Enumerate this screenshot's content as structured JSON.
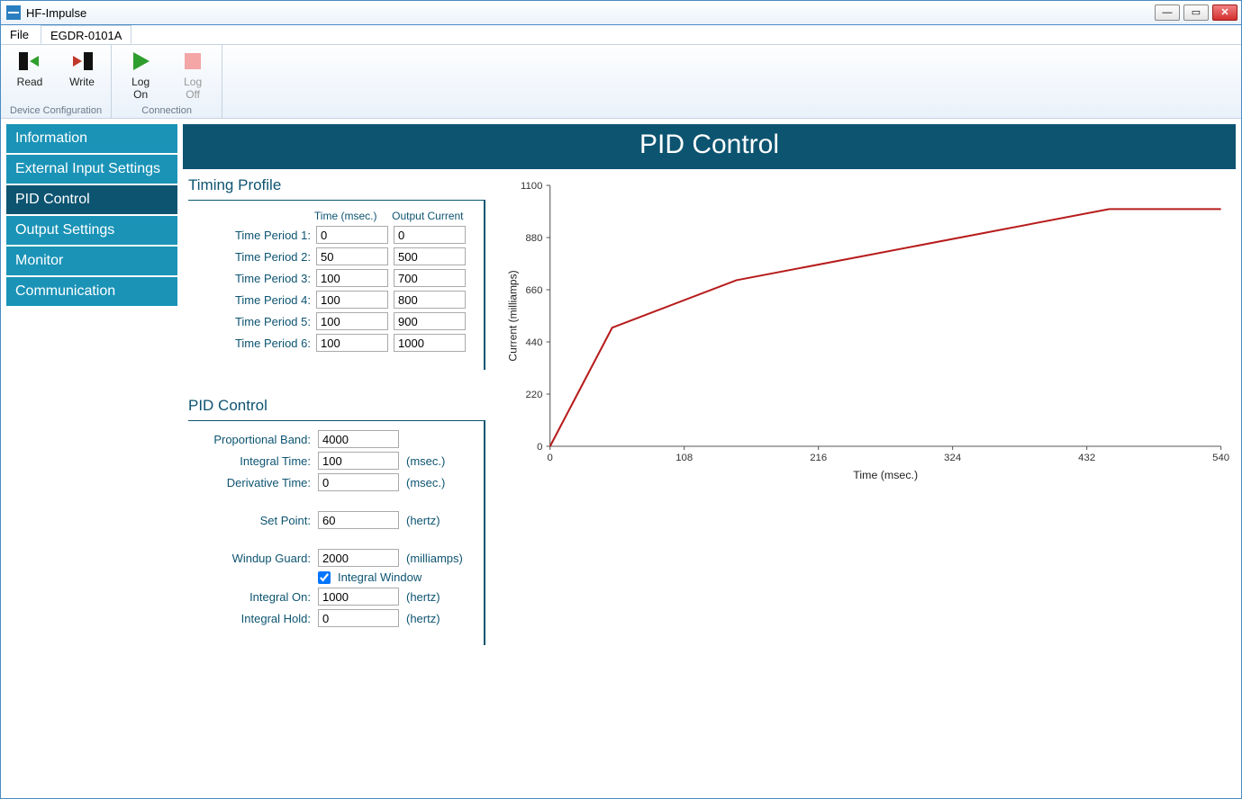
{
  "window": {
    "title": "HF-Impulse"
  },
  "menubar": {
    "file": "File",
    "device_tab": "EGDR-0101A"
  },
  "ribbon": {
    "read": "Read",
    "write": "Write",
    "logon": "Log\nOn",
    "logoff": "Log\nOff",
    "group_device": "Device Configuration",
    "group_conn": "Connection"
  },
  "sidebar": {
    "items": [
      "Information",
      "External Input Settings",
      "PID Control",
      "Output Settings",
      "Monitor",
      "Communication"
    ],
    "active_index": 2
  },
  "page": {
    "title": "PID Control"
  },
  "timing": {
    "section_title": "Timing Profile",
    "col_time": "Time (msec.)",
    "col_output": "Output Current",
    "rows": [
      {
        "label": "Time Period 1:",
        "time": "0",
        "out": "0"
      },
      {
        "label": "Time Period 2:",
        "time": "50",
        "out": "500"
      },
      {
        "label": "Time Period 3:",
        "time": "100",
        "out": "700"
      },
      {
        "label": "Time Period 4:",
        "time": "100",
        "out": "800"
      },
      {
        "label": "Time Period 5:",
        "time": "100",
        "out": "900"
      },
      {
        "label": "Time Period 6:",
        "time": "100",
        "out": "1000"
      }
    ]
  },
  "pid": {
    "section_title": "PID Control",
    "proportional_label": "Proportional Band:",
    "proportional": "4000",
    "integral_time_label": "Integral Time:",
    "integral_time": "100",
    "integral_time_unit": "(msec.)",
    "derivative_time_label": "Derivative Time:",
    "derivative_time": "0",
    "derivative_time_unit": "(msec.)",
    "setpoint_label": "Set Point:",
    "setpoint": "60",
    "setpoint_unit": "(hertz)",
    "windup_label": "Windup Guard:",
    "windup": "2000",
    "windup_unit": "(milliamps)",
    "integral_window_label": "Integral Window",
    "integral_window_checked": true,
    "integral_on_label": "Integral On:",
    "integral_on": "1000",
    "integral_on_unit": "(hertz)",
    "integral_hold_label": "Integral Hold:",
    "integral_hold": "0",
    "integral_hold_unit": "(hertz)"
  },
  "chart_data": {
    "type": "line",
    "xlabel": "Time (msec.)",
    "ylabel": "Current (milliamps)",
    "xlim": [
      0,
      540
    ],
    "ylim": [
      0,
      1100
    ],
    "xticks": [
      0,
      108,
      216,
      324,
      432,
      540
    ],
    "yticks": [
      0,
      220,
      440,
      660,
      880,
      1100
    ],
    "series": [
      {
        "name": "profile",
        "points": [
          {
            "x": 0,
            "y": 0
          },
          {
            "x": 50,
            "y": 500
          },
          {
            "x": 150,
            "y": 700
          },
          {
            "x": 250,
            "y": 800
          },
          {
            "x": 350,
            "y": 900
          },
          {
            "x": 450,
            "y": 1000
          },
          {
            "x": 540,
            "y": 1000
          }
        ]
      }
    ]
  }
}
